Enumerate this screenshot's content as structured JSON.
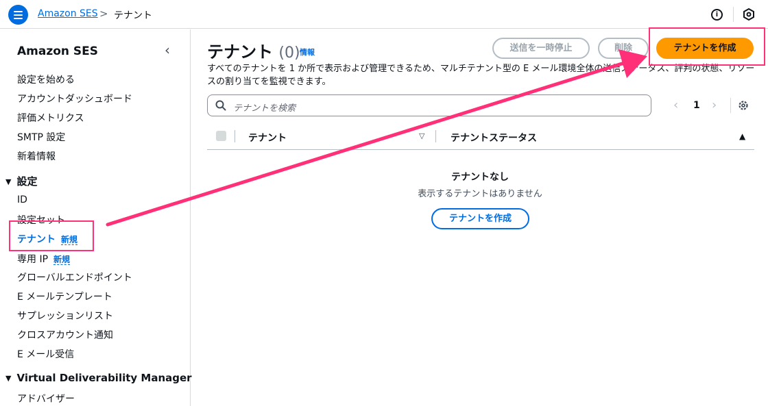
{
  "header": {
    "breadcrumb_link": "Amazon SES",
    "breadcrumb_sep": ">",
    "breadcrumb_current": "テナント"
  },
  "sidebar": {
    "title": "Amazon SES",
    "collapse_glyph": "‹",
    "items_top": [
      {
        "label": "設定を始める"
      },
      {
        "label": "アカウントダッシュボード"
      },
      {
        "label": "評価メトリクス"
      },
      {
        "label": "SMTP 設定"
      },
      {
        "label": "新着情報"
      }
    ],
    "section_settings": "設定",
    "items_settings": [
      {
        "label": "ID"
      },
      {
        "label": "設定セット"
      },
      {
        "label": "テナント",
        "badge": "新規"
      },
      {
        "label": "専用 IP",
        "badge": "新規"
      },
      {
        "label": "グローバルエンドポイント"
      },
      {
        "label": "E メールテンプレート"
      },
      {
        "label": "サプレッションリスト"
      },
      {
        "label": "クロスアカウント通知"
      },
      {
        "label": "E メール受信"
      }
    ],
    "section_vdm": "Virtual Deliverability Manager",
    "items_vdm": [
      {
        "label": "アドバイザー"
      }
    ]
  },
  "main": {
    "title": "テナント",
    "count": "(0)",
    "info_link": "情報",
    "description": "すべてのテナントを 1 か所で表示および管理できるため、マルチテナント型の E メール環境全体の送信ステータス、評判の状態、リソースの割り当てを監視できます。",
    "buttons": {
      "pause": "送信を一時停止",
      "delete": "削除",
      "create": "テナントを作成"
    },
    "search_placeholder": "テナントを検索",
    "pagination": {
      "prev": "‹",
      "page": "1",
      "next": "›"
    },
    "table": {
      "columns": [
        "テナント",
        "テナントステータス"
      ]
    },
    "empty": {
      "title": "テナントなし",
      "subtitle": "表示するテナントはありません",
      "create_button": "テナントを作成"
    }
  },
  "colors": {
    "accent_blue": "#006ce0",
    "primary_orange": "#ff9900",
    "annotation_pink": "#ff2f78"
  }
}
